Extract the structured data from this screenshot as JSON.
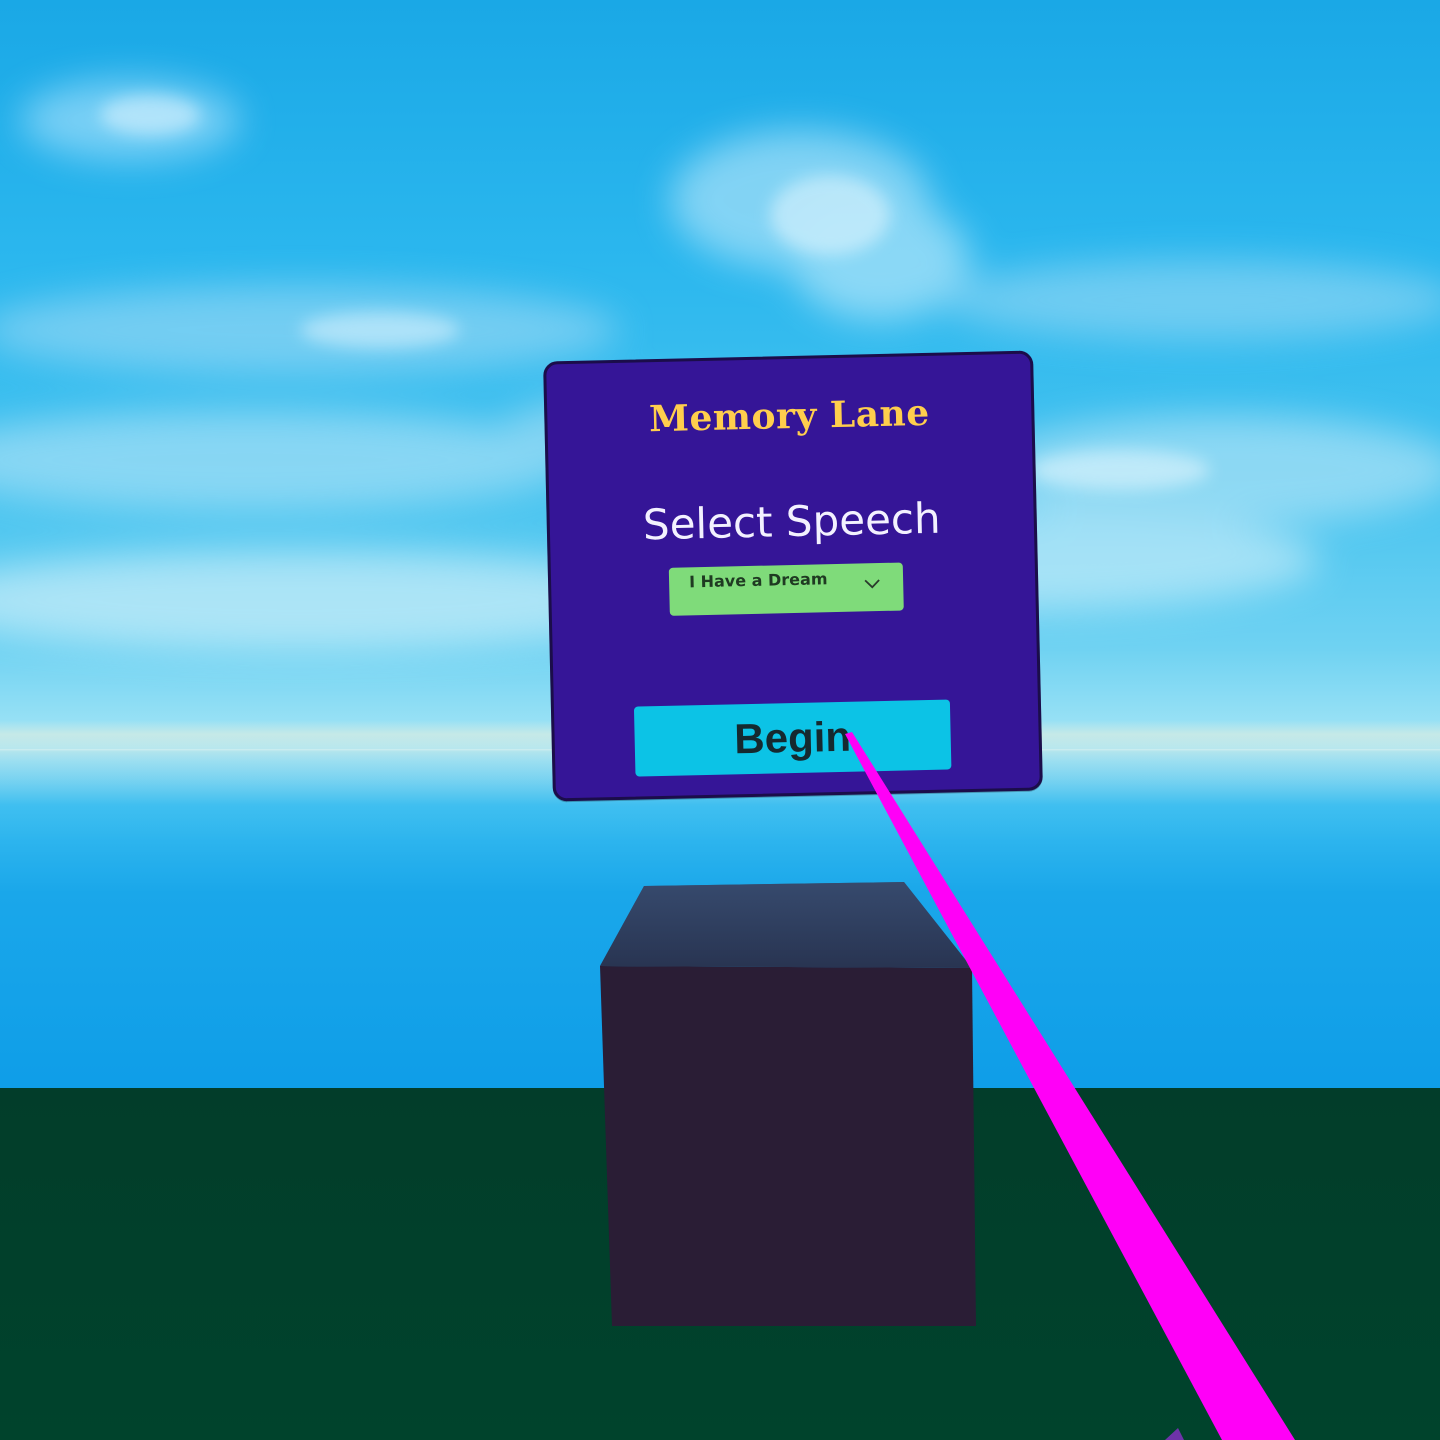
{
  "menu": {
    "title": "Memory Lane",
    "subtitle": "Select Speech",
    "speech_select": {
      "selected_value": "I Have a Dream"
    },
    "begin_label": "Begin"
  },
  "colors": {
    "panel": "#351597",
    "title": "#ffce4d",
    "dropdown": "#7fdb7a",
    "begin_button": "#0cc3e6",
    "laser": "#ff00ff",
    "cube": "#2c1e35",
    "ground": "#00432c"
  },
  "icons": {
    "dropdown_chevron": "chevron-down-icon"
  }
}
